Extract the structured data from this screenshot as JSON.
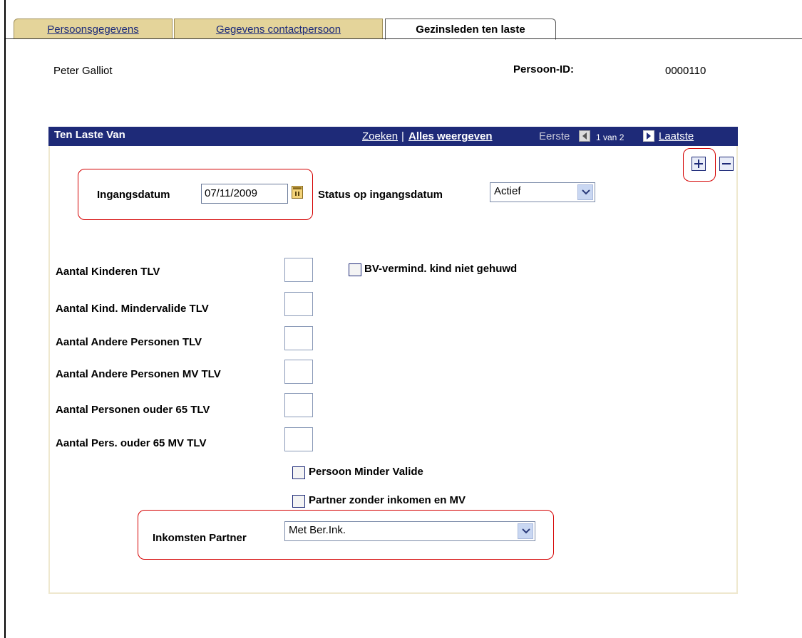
{
  "tabs": [
    {
      "label": "Persoonsgegevens",
      "state": "inactive"
    },
    {
      "label": "Gegevens contactpersoon",
      "state": "inactive"
    },
    {
      "label": "Gezinsleden ten laste",
      "state": "active"
    }
  ],
  "person": {
    "name": "Peter Galliot",
    "id_label": "Persoon-ID:",
    "id_value": "0000110"
  },
  "panel": {
    "title": "Ten Laste Van",
    "search_link": "Zoeken",
    "separator": "|",
    "show_all_link": "Alles weergeven",
    "first_label": "Eerste",
    "pagination": "1 van 2",
    "last_link": "Laatste"
  },
  "form": {
    "ingangsdatum_label": "Ingangsdatum",
    "ingangsdatum_value": "07/11/2009",
    "status_label": "Status op ingangsdatum",
    "status_value": "Actief",
    "bv_checkbox_label": "BV-vermind. kind niet gehuwd",
    "counts": [
      {
        "label": "Aantal Kinderen TLV"
      },
      {
        "label": "Aantal Kind. Mindervalide TLV"
      },
      {
        "label": "Aantal Andere Personen TLV"
      },
      {
        "label": "Aantal Andere Personen MV TLV"
      },
      {
        "label": "Aantal Personen ouder 65 TLV"
      },
      {
        "label": "Aantal Pers. ouder 65 MV TLV"
      }
    ],
    "minder_valide_label": "Persoon Minder Valide",
    "partner_label": "Partner zonder inkomen en MV",
    "inkomsten_label": "Inkomsten Partner",
    "inkomsten_value": "Met Ber.Ink."
  },
  "colors": {
    "header_bg": "#1e2a78",
    "tab_inactive": "#e4d49a",
    "highlight": "#d40000"
  }
}
